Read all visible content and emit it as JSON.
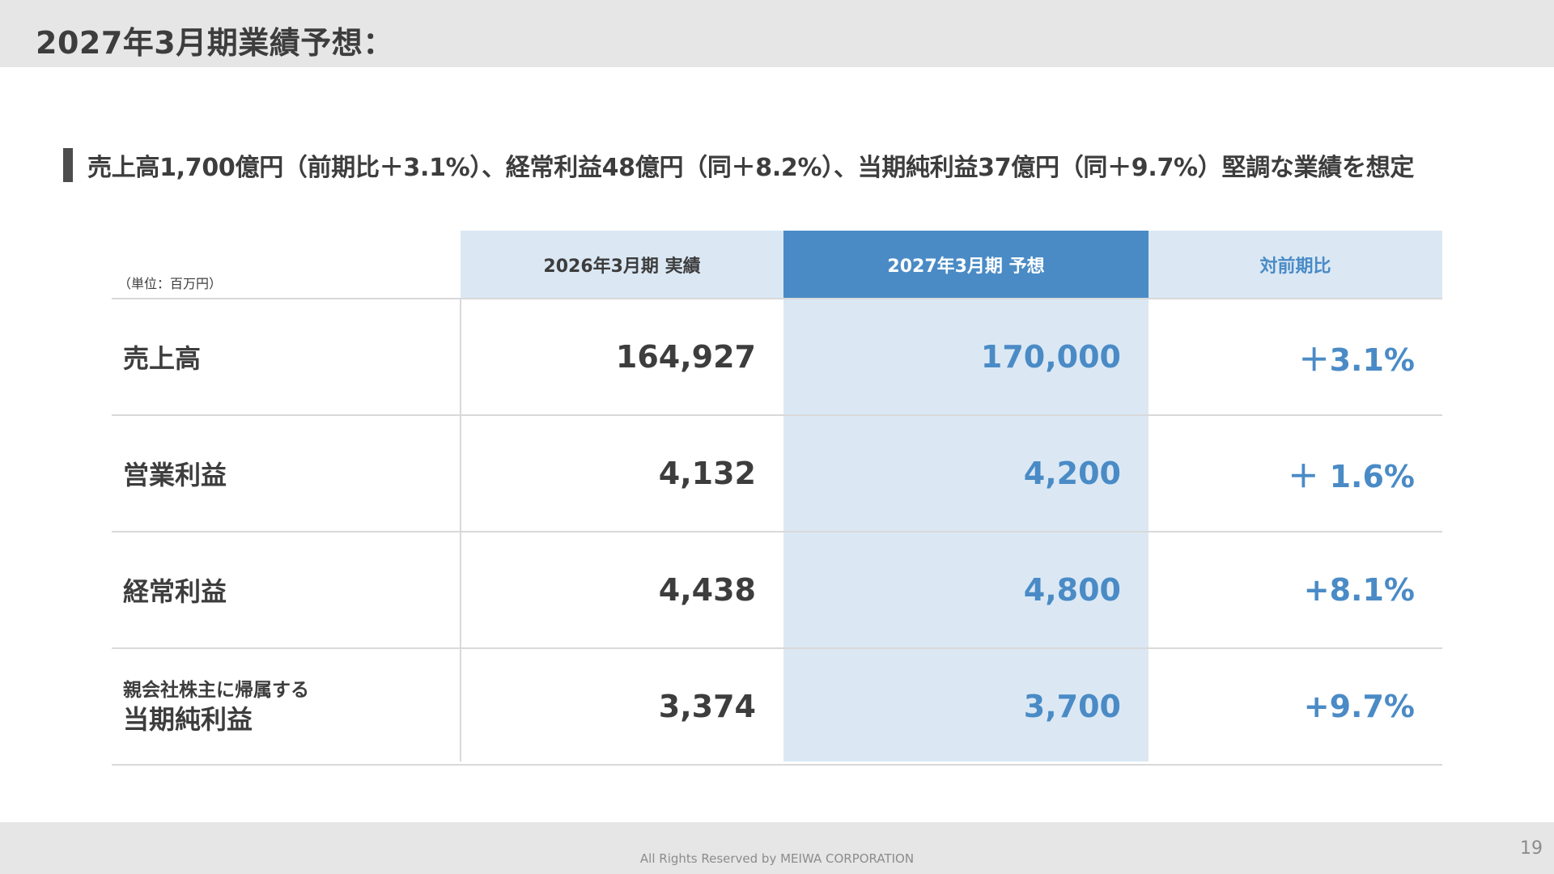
{
  "header": {
    "title": "2027年3月期業績予想："
  },
  "summary": {
    "text": "売上高1,700億円（前期比＋3.1%）、経常利益48億円（同＋8.2%）、当期純利益37億円（同＋9.7%）堅調な業績を想定"
  },
  "table": {
    "unit": "（単位：百万円）",
    "columns": [
      "2026年3月期 実績",
      "2027年3月期 予想",
      "対前期比"
    ],
    "rows": [
      {
        "label": "売上高",
        "actual": "164,927",
        "forecast": "170,000",
        "change": "＋3.1%"
      },
      {
        "label": "営業利益",
        "actual": "4,132",
        "forecast": "4,200",
        "change": "＋ 1.6%"
      },
      {
        "label": "経常利益",
        "actual": "4,438",
        "forecast": "4,800",
        "change": "+8.1%"
      },
      {
        "label_line1": "親会社株主に帰属する",
        "label_line2": "当期純利益",
        "actual": "3,374",
        "forecast": "3,700",
        "change": "+9.7%"
      }
    ]
  },
  "footer": {
    "copyright": "All Rights Reserved by MEIWA CORPORATION",
    "page_number": "19"
  },
  "colors": {
    "header_bg": "#e6e6e6",
    "accent_blue": "#4a8bc6",
    "light_blue": "#dbe8f4",
    "text_dark": "#3d3d3d"
  }
}
